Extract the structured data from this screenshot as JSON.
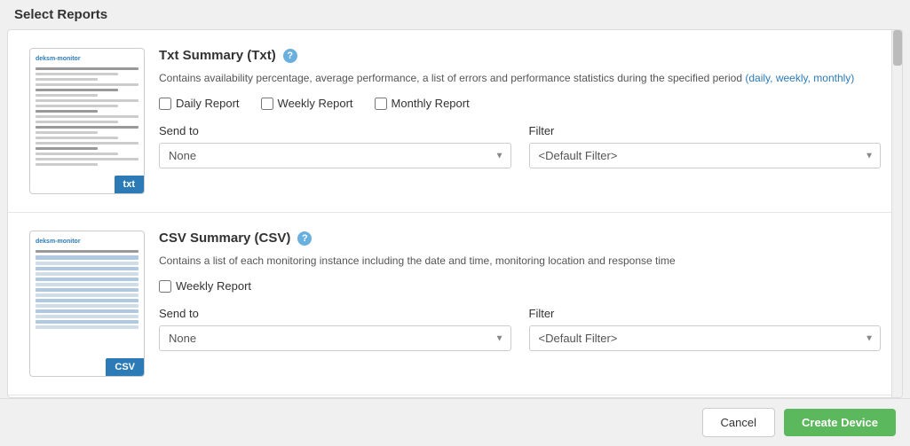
{
  "page": {
    "title": "Select Reports"
  },
  "scrollbar": {
    "visible": true
  },
  "reports": [
    {
      "id": "txt",
      "title": "Txt Summary (Txt)",
      "thumb_label": "txt",
      "description": "Contains availability percentage, average performance, a list of errors and performance statistics during the specified period (daily, weekly, monthly)",
      "description_link_text": "(daily, weekly, monthly)",
      "checkboxes": [
        {
          "id": "txt-daily",
          "label": "Daily Report",
          "checked": false
        },
        {
          "id": "txt-weekly",
          "label": "Weekly Report",
          "checked": false
        },
        {
          "id": "txt-monthly",
          "label": "Monthly Report",
          "checked": false
        }
      ],
      "send_to_label": "Send to",
      "send_to_value": "None",
      "send_to_placeholder": "None",
      "filter_label": "Filter",
      "filter_value": "<Default Filter>",
      "filter_placeholder": "<Default Filter>"
    },
    {
      "id": "csv",
      "title": "CSV Summary (CSV)",
      "thumb_label": "CSV",
      "description": "Contains a list of each monitoring instance including the date and time, monitoring location and response time",
      "description_link_text": "",
      "checkboxes": [
        {
          "id": "csv-weekly",
          "label": "Weekly Report",
          "checked": false
        }
      ],
      "send_to_label": "Send to",
      "send_to_value": "None",
      "send_to_placeholder": "None",
      "filter_label": "Filter",
      "filter_value": "<Default Filter>",
      "filter_placeholder": "<Default Filter>"
    }
  ],
  "footer": {
    "cancel_label": "Cancel",
    "create_label": "Create Device"
  }
}
